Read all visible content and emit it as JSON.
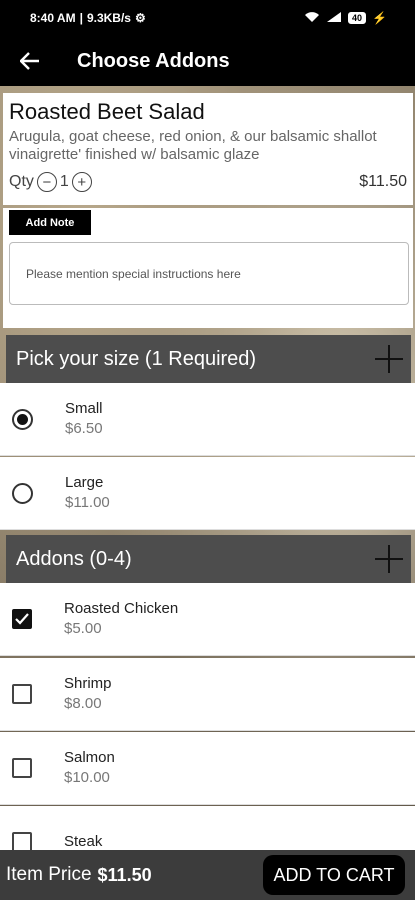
{
  "status_bar": {
    "time": "8:40 AM",
    "speed": "9.3KB/s",
    "battery": "40"
  },
  "app_bar": {
    "title": "Choose Addons"
  },
  "item": {
    "name": "Roasted Beet Salad",
    "description": "Arugula, goat cheese, red onion, & our balsamic shallot vinaigrette' finished w/ balsamic glaze",
    "qty_label": "Qty",
    "qty": "1",
    "price": "$11.50"
  },
  "note": {
    "tag": "Add Note",
    "placeholder": "Please mention special instructions here"
  },
  "size_section": {
    "title": "Pick your size (1 Required)",
    "options": [
      {
        "name": "Small",
        "price": "$6.50",
        "selected": true
      },
      {
        "name": "Large",
        "price": "$11.00",
        "selected": false
      }
    ]
  },
  "addons_section": {
    "title": "Addons (0-4)",
    "options": [
      {
        "name": "Roasted Chicken",
        "price": "$5.00",
        "checked": true
      },
      {
        "name": "Shrimp",
        "price": "$8.00",
        "checked": false
      },
      {
        "name": "Salmon",
        "price": "$10.00",
        "checked": false
      },
      {
        "name": "Steak",
        "price": "",
        "checked": false
      }
    ]
  },
  "bottom_bar": {
    "label": "Item Price",
    "price": "$11.50",
    "cta": "ADD TO CART"
  }
}
